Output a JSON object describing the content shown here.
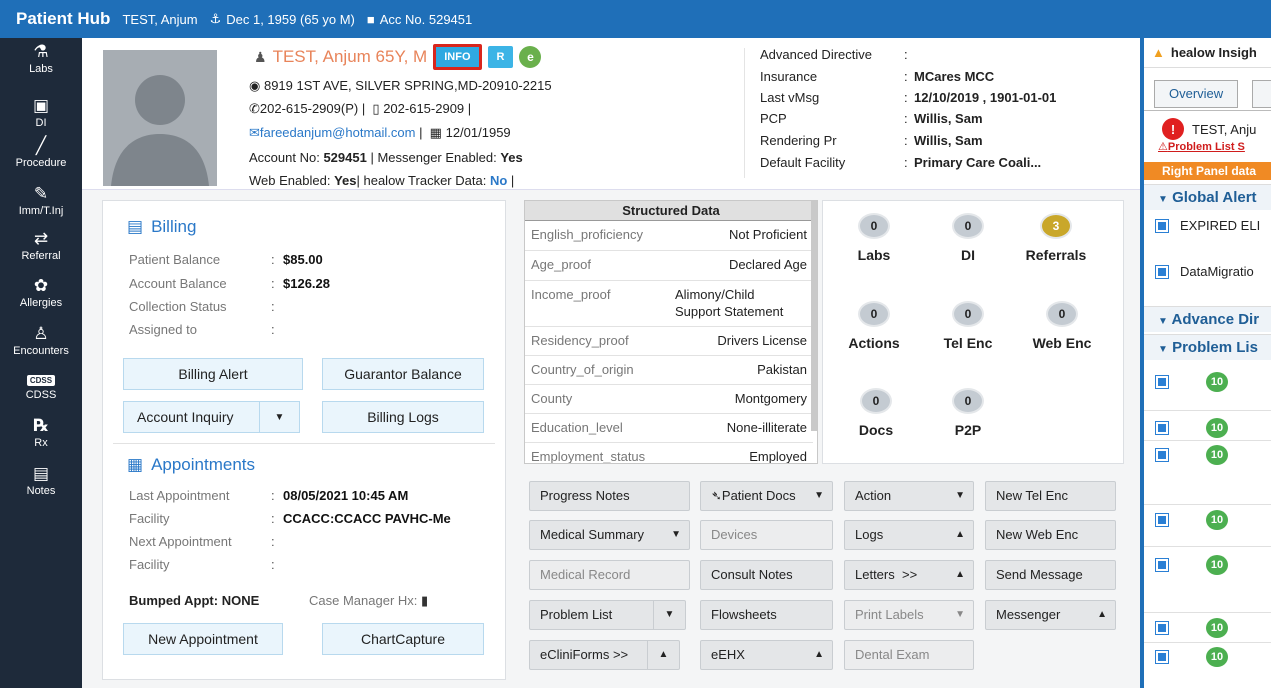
{
  "header": {
    "title": "Patient Hub",
    "patient": "TEST, Anjum",
    "dob": "Dec 1, 1959 (65 yo M)",
    "account": "Acc No. 529451"
  },
  "sidebar": [
    {
      "label": "Labs",
      "icon": "flask-icon"
    },
    {
      "label": "DI",
      "icon": "xray-icon"
    },
    {
      "label": "Procedure",
      "icon": "scalpel-icon"
    },
    {
      "label": "Imm/T.Inj",
      "icon": "syringe-icon"
    },
    {
      "label": "Referral",
      "icon": "arrows-icon"
    },
    {
      "label": "Allergies",
      "icon": "allergy-icon"
    },
    {
      "label": "Encounters",
      "icon": "person-icon"
    },
    {
      "label": "CDSS",
      "icon": "cdss-icon",
      "badge": "CDSS"
    },
    {
      "label": "Rx",
      "icon": "rx-icon"
    },
    {
      "label": "Notes",
      "icon": "notes-icon"
    }
  ],
  "patient": {
    "name": "TEST, Anjum 65Y, M",
    "info_btn": "INFO",
    "r_btn": "R",
    "h_btn": "e",
    "address": "8919 1ST AVE, SILVER SPRING,MD-20910-2215",
    "phone": "202-615-2909(P)",
    "mobile": "202-615-2909",
    "email": "fareedanjum@hotmail.com",
    "dob": "12/01/1959",
    "account_label": "Account No:",
    "account_no": "529451",
    "messenger_label": "Messenger Enabled:",
    "messenger": "Yes",
    "web_label": "Web Enabled:",
    "web": "Yes",
    "tracker_label": "healow Tracker Data:",
    "tracker": "No"
  },
  "details": [
    {
      "k": "Advanced Directive",
      "v": ""
    },
    {
      "k": "Insurance",
      "v": "MCares MCC"
    },
    {
      "k": "Last vMsg",
      "v": "12/10/2019 , 1901-01-01"
    },
    {
      "k": "PCP",
      "v": "Willis, Sam"
    },
    {
      "k": "Rendering Pr",
      "v": "Willis, Sam"
    },
    {
      "k": "Default Facility",
      "v": "Primary Care Coali..."
    }
  ],
  "billing": {
    "title": "Billing",
    "rows": [
      {
        "k": "Patient Balance",
        "v": "$85.00"
      },
      {
        "k": "Account Balance",
        "v": "$126.28"
      },
      {
        "k": "Collection Status",
        "v": ""
      },
      {
        "k": "Assigned to",
        "v": ""
      }
    ],
    "alert_btn": "Billing Alert",
    "guarantor_btn": "Guarantor Balance",
    "inquiry_btn": "Account Inquiry",
    "logs_btn": "Billing Logs"
  },
  "appointments": {
    "title": "Appointments",
    "rows": [
      {
        "k": "Last Appointment",
        "v": "08/05/2021 10:45 AM"
      },
      {
        "k": "Facility",
        "v": "CCACC:CCACC PAVHC-Me"
      },
      {
        "k": "Next Appointment",
        "v": ""
      },
      {
        "k": "Facility",
        "v": ""
      }
    ],
    "bumped_label": "Bumped Appt:",
    "bumped": "NONE",
    "case_mgr": "Case Manager Hx:",
    "new_btn": "New Appointment",
    "chart_btn": "ChartCapture"
  },
  "structured": {
    "title": "Structured Data",
    "rows": [
      {
        "k": "English_proficiency",
        "v": "Not Proficient"
      },
      {
        "k": "Age_proof",
        "v": "Declared Age"
      },
      {
        "k": "Income_proof",
        "v": "Alimony/Child\nSupport Statement"
      },
      {
        "k": "Residency_proof",
        "v": "Drivers License"
      },
      {
        "k": "Country_of_origin",
        "v": "Pakistan"
      },
      {
        "k": "County",
        "v": "Montgomery"
      },
      {
        "k": "Education_level",
        "v": "None-illiterate"
      },
      {
        "k": "Employment_status",
        "v": "Employed"
      }
    ]
  },
  "counters": [
    {
      "label": "Labs",
      "count": "0"
    },
    {
      "label": "DI",
      "count": "0"
    },
    {
      "label": "Referrals",
      "count": "3"
    },
    {
      "label": "Actions",
      "count": "0"
    },
    {
      "label": "Tel Enc",
      "count": "0"
    },
    {
      "label": "Web Enc",
      "count": "0"
    },
    {
      "label": "Docs",
      "count": "0"
    },
    {
      "label": "P2P",
      "count": "0"
    }
  ],
  "actions": [
    {
      "label": "Progress Notes"
    },
    {
      "label": "Patient Docs"
    },
    {
      "label": "Action"
    },
    {
      "label": "New Tel Enc"
    },
    {
      "label": "Medical Summary"
    },
    {
      "label": "Devices"
    },
    {
      "label": "Logs"
    },
    {
      "label": "New Web Enc"
    },
    {
      "label": "Medical Record"
    },
    {
      "label": "Consult Notes"
    },
    {
      "label": "Letters"
    },
    {
      "label": "Send Message"
    },
    {
      "label": "Problem List"
    },
    {
      "label": "Flowsheets"
    },
    {
      "label": "Print Labels"
    },
    {
      "label": "Messenger"
    },
    {
      "label": "eCliniForms"
    },
    {
      "label": "eEHX"
    },
    {
      "label": "Dental Exam"
    }
  ],
  "right_panel": {
    "title": "healow Insigh",
    "tab1": "Overview",
    "patient": "TEST, Anju",
    "problem_link": "Problem List S",
    "banner": "Right Panel data",
    "global_alerts": "Global Alert",
    "alert1": "EXPIRED ELI",
    "alert2": "DataMigratio",
    "advance_dir": "Advance Dir",
    "problem_list": "Problem Lis",
    "badge": "10"
  }
}
